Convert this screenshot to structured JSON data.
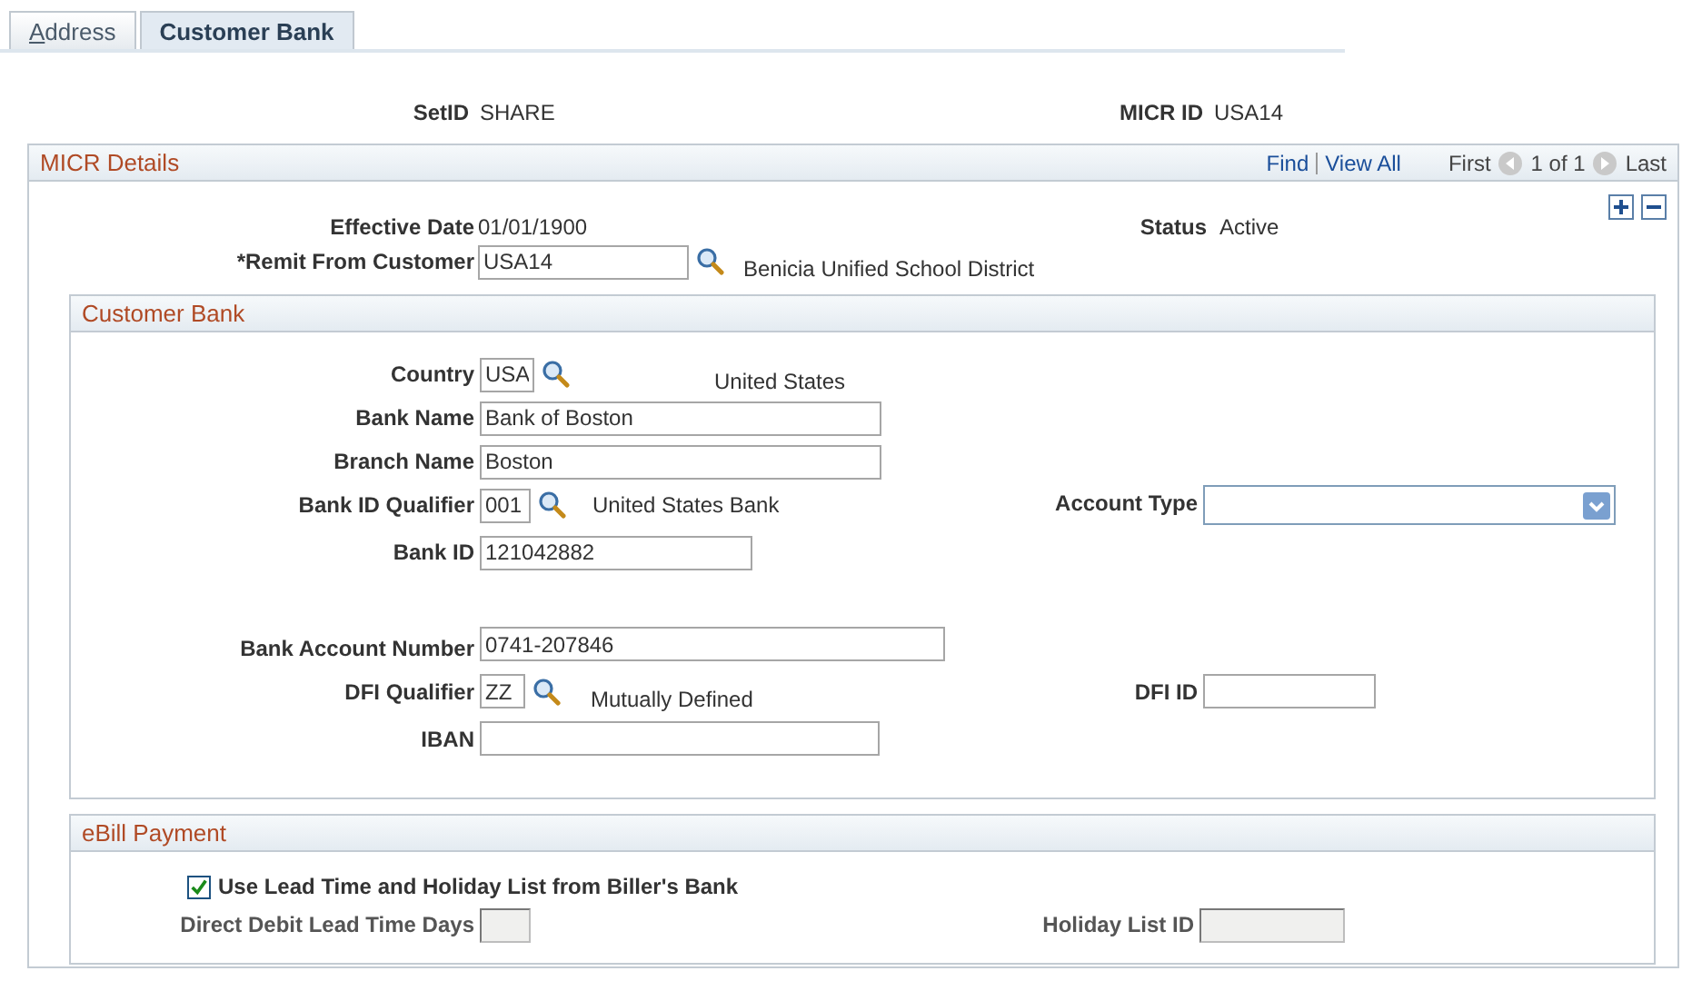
{
  "tabs": [
    {
      "label": "Address",
      "selected": false
    },
    {
      "label": "Customer Bank",
      "selected": true
    }
  ],
  "header": {
    "setid": {
      "label": "SetID",
      "value": "SHARE"
    },
    "micr_id": {
      "label": "MICR ID",
      "value": "USA14"
    }
  },
  "micr_details": {
    "title": "MICR Details",
    "nav": {
      "find": "Find",
      "view_all": "View All",
      "first": "First",
      "counter": "1 of 1",
      "last": "Last"
    },
    "effective_date": {
      "label": "Effective Date",
      "value": "01/01/1900"
    },
    "status": {
      "label": "Status",
      "value": "Active"
    },
    "remit_from_customer": {
      "label": "*Remit From Customer",
      "value": "USA14",
      "description": "Benicia Unified School District"
    }
  },
  "customer_bank": {
    "title": "Customer Bank",
    "country": {
      "label": "Country",
      "value": "USA",
      "description": "United States"
    },
    "bank_name": {
      "label": "Bank Name",
      "value": "Bank of Boston"
    },
    "branch_name": {
      "label": "Branch Name",
      "value": "Boston"
    },
    "bank_id_qualifier": {
      "label": "Bank ID Qualifier",
      "value": "001",
      "description": "United States Bank"
    },
    "account_type": {
      "label": "Account Type"
    },
    "bank_id": {
      "label": "Bank ID",
      "value": "121042882"
    },
    "bank_account_number": {
      "label": "Bank Account Number",
      "value": "0741-207846"
    },
    "dfi_qualifier": {
      "label": "DFI Qualifier",
      "value": "ZZ",
      "description": "Mutually Defined"
    },
    "dfi_id": {
      "label": "DFI ID"
    },
    "iban": {
      "label": "IBAN"
    }
  },
  "ebill_payment": {
    "title": "eBill Payment",
    "use_lead_time": {
      "label": "Use Lead Time and Holiday List from Biller's Bank",
      "checked": true
    },
    "direct_debit_lead_time_days": {
      "label": "Direct Debit Lead Time Days",
      "disabled": true
    },
    "holiday_list_id": {
      "label": "Holiday List ID",
      "disabled": true
    }
  }
}
